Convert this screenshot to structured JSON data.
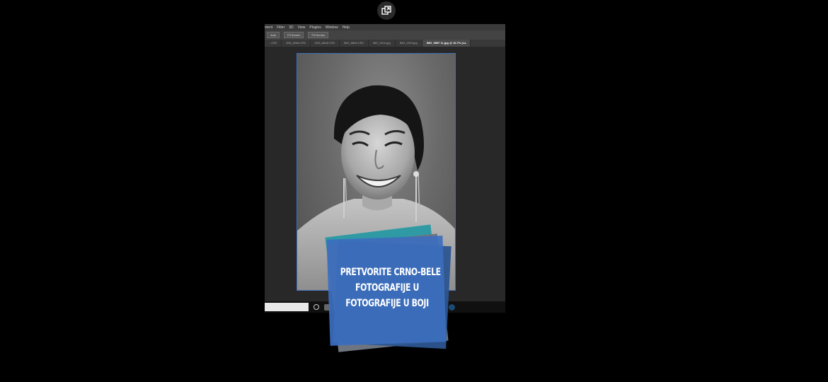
{
  "menu": {
    "items": [
      "ment",
      "Filter",
      "3D",
      "View",
      "Plugins",
      "Window",
      "Help"
    ]
  },
  "options": {
    "buttons": [
      "Auto",
      "Fit Screen",
      "Fill Screen"
    ]
  },
  "tabs": [
    {
      "label": "...CR2",
      "active": false
    },
    {
      "label": "IMG_8563.CR2",
      "active": false
    },
    {
      "label": "IMG_8648.CR2",
      "active": false
    },
    {
      "label": "IMG_8848.CR2",
      "active": false
    },
    {
      "label": "IMG_0011.jpg",
      "active": false
    },
    {
      "label": "IMG_0019.jpg",
      "active": false
    },
    {
      "label": "IMG_9857 11.jpg @ 16.7% (La",
      "active": true
    }
  ],
  "promo": {
    "lines": [
      "PRETVORITE CRNO-BELE",
      "FOTOGRAFIJE U",
      "FOTOGRAFIJE U BOJI"
    ]
  },
  "colors": {
    "selection_border": "#3f6fb8",
    "promo_blue": "#3c6ebe",
    "promo_teal": "#2f9aa3"
  },
  "icons": {
    "pip_button": "picture-in-picture-icon"
  }
}
